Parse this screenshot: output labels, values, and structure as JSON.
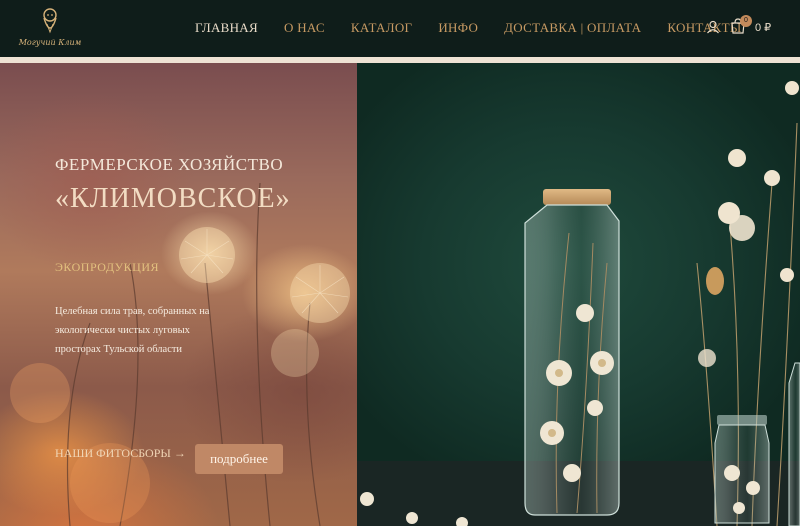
{
  "header": {
    "logo_text": "Могучий Клим",
    "nav": [
      {
        "label": "ГЛАВНАЯ",
        "active": true
      },
      {
        "label": "О НАС",
        "active": false
      },
      {
        "label": "КАТАЛОГ",
        "active": false
      },
      {
        "label": "ИНФО",
        "active": false
      },
      {
        "label": "ДОСТАВКА | ОПЛАТА",
        "active": false
      },
      {
        "label": "КОНТАКТЫ",
        "active": false
      }
    ],
    "cart_count": "0",
    "cart_total": "0 ₽",
    "icons": [
      "user-icon",
      "cart-icon"
    ]
  },
  "hero": {
    "subtitle": "ФЕРМЕРСКОЕ ХОЗЯЙСТВО",
    "title": "«КЛИМОВСКОЕ»",
    "tag": "ЭКОПРОДУКЦИЯ",
    "description": "Целебная сила трав, собранных на экологически чистых луговых просторах Тульской области",
    "link": "НАШИ ФИТОСБОРЫ →",
    "button": "подробнее"
  },
  "colors": {
    "header_bg": "#0f1d1a",
    "nav_text": "#c79a63",
    "nav_active": "#e9dcc9",
    "accent": "#c08866",
    "gold": "#e2c07e",
    "panel_green": "#173a30"
  }
}
